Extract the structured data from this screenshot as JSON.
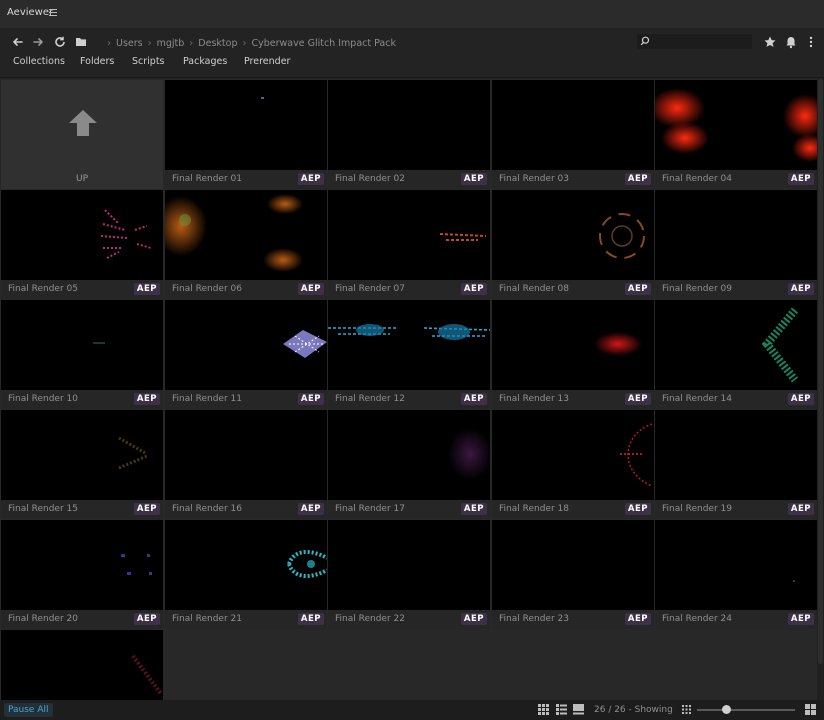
{
  "app": {
    "title": "Aeviewer"
  },
  "breadcrumb": [
    "Users",
    "mgjtb",
    "Desktop",
    "Cyberwave Glitch Impact Pack"
  ],
  "search": {
    "value": "",
    "placeholder": ""
  },
  "tabs": [
    {
      "label": "Collections"
    },
    {
      "label": "Folders"
    },
    {
      "label": "Scripts"
    },
    {
      "label": "Packages"
    },
    {
      "label": "Prerender"
    }
  ],
  "up_tile": {
    "label": "UP"
  },
  "badge_label": "AEP",
  "items": [
    {
      "name": "Final Render 01"
    },
    {
      "name": "Final Render 02"
    },
    {
      "name": "Final Render 03"
    },
    {
      "name": "Final Render 04"
    },
    {
      "name": "Final Render 05"
    },
    {
      "name": "Final Render 06"
    },
    {
      "name": "Final Render 07"
    },
    {
      "name": "Final Render 08"
    },
    {
      "name": "Final Render 09"
    },
    {
      "name": "Final Render 10"
    },
    {
      "name": "Final Render 11"
    },
    {
      "name": "Final Render 12"
    },
    {
      "name": "Final Render 13"
    },
    {
      "name": "Final Render 14"
    },
    {
      "name": "Final Render 15"
    },
    {
      "name": "Final Render 16"
    },
    {
      "name": "Final Render 17"
    },
    {
      "name": "Final Render 18"
    },
    {
      "name": "Final Render 19"
    },
    {
      "name": "Final Render 20"
    },
    {
      "name": "Final Render 21"
    },
    {
      "name": "Final Render 22"
    },
    {
      "name": "Final Render 23"
    },
    {
      "name": "Final Render 24"
    },
    {
      "name": ""
    }
  ],
  "status": {
    "pause_label": "Pause All",
    "count_text": "26 / 26 - Showing",
    "zoom_level": 0.3
  },
  "icons": {
    "back": "arrow-left-icon",
    "forward": "arrow-right-icon",
    "refresh": "refresh-icon",
    "folder": "folder-icon",
    "search": "search-icon",
    "favorites": "star-icon",
    "notifications": "bell-icon",
    "more": "more-vertical-icon",
    "up": "arrow-up-icon",
    "view_grid": "grid-view-icon",
    "view_list": "list-view-icon",
    "view_large": "large-thumb-view-icon",
    "zoom_small": "small-grid-icon",
    "zoom_large": "large-grid-icon"
  },
  "colors": {
    "badge_bg": "#3e3147",
    "pause_text": "#4fa3d1"
  }
}
